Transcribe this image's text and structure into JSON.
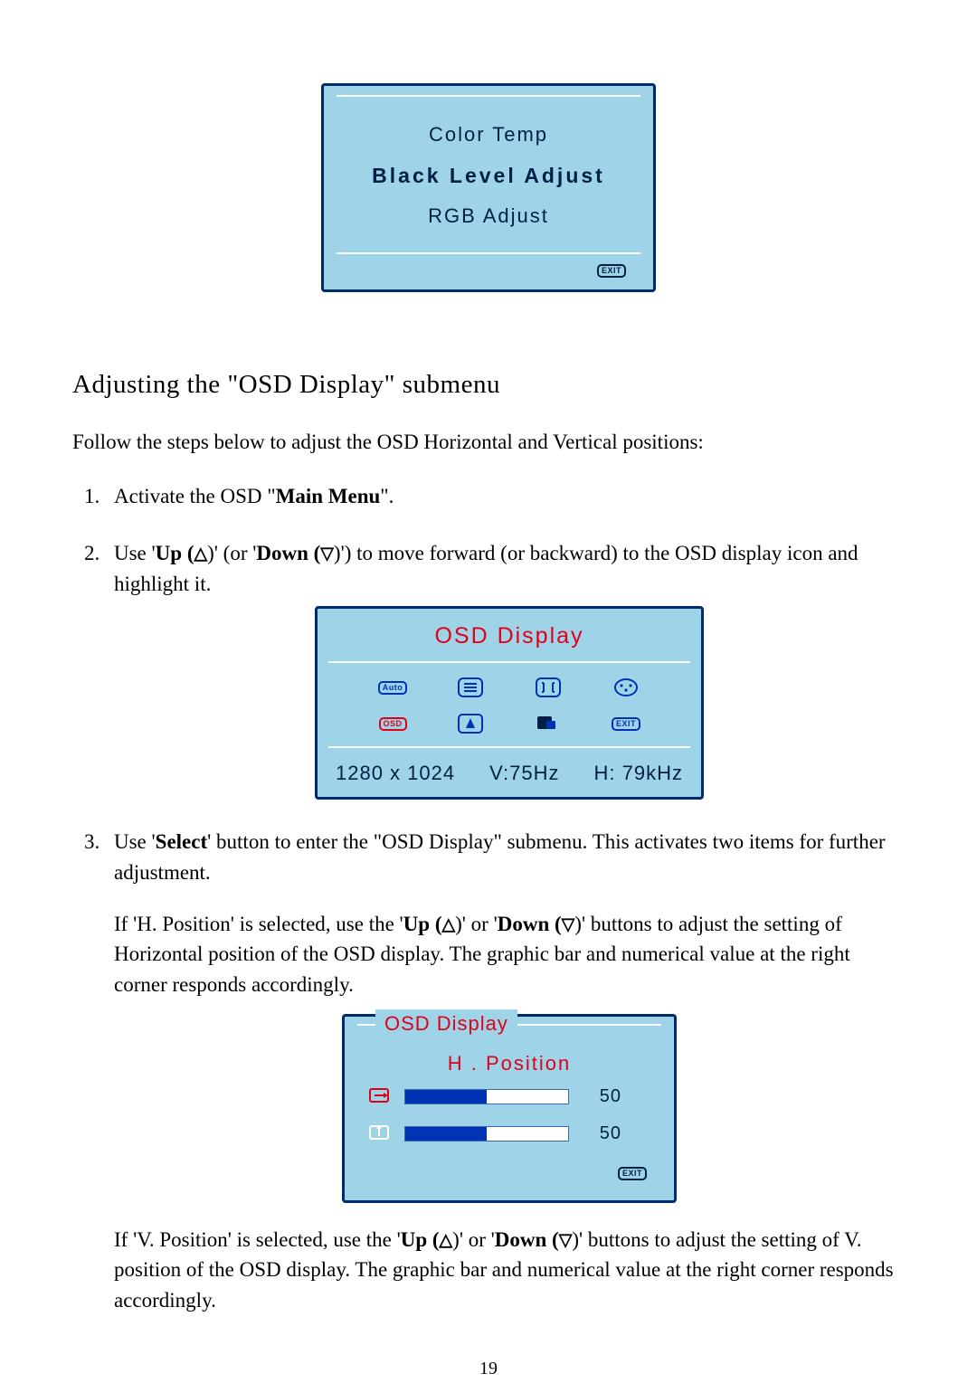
{
  "panel1": {
    "items": [
      "Color Temp",
      "Black Level Adjust",
      "RGB Adjust"
    ],
    "selected_index": 1,
    "exit_label": "EXIT"
  },
  "section_title": "Adjusting the \"OSD Display\" submenu",
  "lead": "Follow the steps below to adjust the OSD Horizontal and Vertical positions:",
  "up_glyph": "△",
  "down_glyph": "▽",
  "steps": {
    "s1_pre": "Activate the OSD \"",
    "s1_bold": "Main Menu",
    "s1_post": "\".",
    "s2_a": "Use '",
    "s2_up_bold": "Up (",
    "s2_b": ")' (or '",
    "s2_down_bold": "Down (",
    "s2_c": ")') to move forward (or backward) to the OSD display icon and highlight it.",
    "s3_a": "Use '",
    "s3_select_bold": "Select",
    "s3_b": "' button to enter the \"OSD Display\" submenu. This activates two items for further adjustment.",
    "s3_h_a": "If 'H. Position' is selected, use the '",
    "s3_h_b": ")' or '",
    "s3_h_c": ")' buttons to adjust the setting of Horizontal position of the OSD display. The graphic bar and numerical value at the right corner responds accordingly.",
    "s3_v_a": "If 'V. Position' is selected, use the '",
    "s3_v_b": ")' or '",
    "s3_v_c": ")' buttons to adjust the setting of V. position of the OSD display. The graphic bar and numerical value at the right corner responds accordingly."
  },
  "panel2": {
    "title": "OSD Display",
    "icons": [
      "auto",
      "menu",
      "size",
      "color",
      "osd",
      "info",
      "lang",
      "exit"
    ],
    "text_badges": {
      "auto": "Auto",
      "osd": "OSD",
      "exit": "EXIT"
    },
    "highlight": "osd",
    "status": {
      "res": "1280 x 1024",
      "v": "V:75Hz",
      "h": "H: 79kHz"
    }
  },
  "panel3": {
    "title": "OSD Display",
    "selected_label": "H . Position",
    "rows": [
      {
        "icon": "h-pos",
        "value": 50,
        "percent": 50
      },
      {
        "icon": "v-pos",
        "value": 50,
        "percent": 50
      }
    ],
    "exit_label": "EXIT"
  },
  "page_number": "19"
}
